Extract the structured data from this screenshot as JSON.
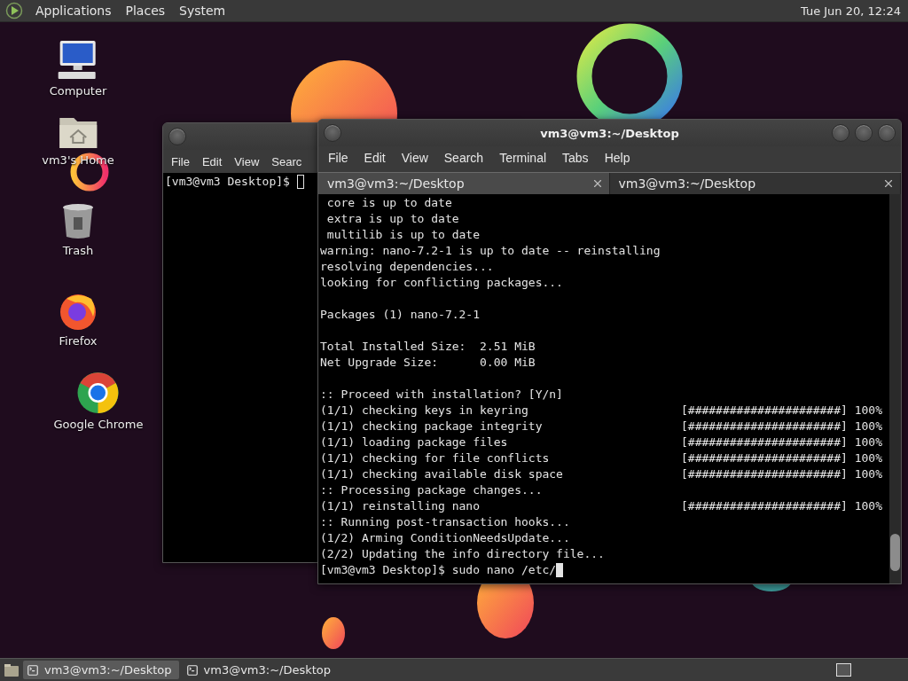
{
  "top_panel": {
    "menus": [
      "Applications",
      "Places",
      "System"
    ],
    "clock": "Tue Jun 20, 12:24"
  },
  "desktop_icons": [
    {
      "kind": "computer",
      "label": "Computer"
    },
    {
      "kind": "home",
      "label": "vm3's Home"
    },
    {
      "kind": "trash",
      "label": "Trash"
    },
    {
      "kind": "firefox",
      "label": "Firefox"
    },
    {
      "kind": "chrome",
      "label": "Google Chrome"
    }
  ],
  "back_window": {
    "menu": [
      "File",
      "Edit",
      "View",
      "Searc"
    ],
    "prompt": "[vm3@vm3 Desktop]$"
  },
  "front_window": {
    "title": "vm3@vm3:~/Desktop",
    "menu": [
      "File",
      "Edit",
      "View",
      "Search",
      "Terminal",
      "Tabs",
      "Help"
    ],
    "tabs": [
      {
        "label": "vm3@vm3:~/Desktop",
        "selected": true
      },
      {
        "label": "vm3@vm3:~/Desktop",
        "selected": false
      }
    ],
    "lines": [
      {
        "kind": "text",
        "text": " core is up to date"
      },
      {
        "kind": "text",
        "text": " extra is up to date"
      },
      {
        "kind": "text",
        "text": " multilib is up to date"
      },
      {
        "kind": "text",
        "text": "warning: nano-7.2-1 is up to date -- reinstalling"
      },
      {
        "kind": "text",
        "text": "resolving dependencies..."
      },
      {
        "kind": "text",
        "text": "looking for conflicting packages..."
      },
      {
        "kind": "blank"
      },
      {
        "kind": "text",
        "text": "Packages (1) nano-7.2-1"
      },
      {
        "kind": "blank"
      },
      {
        "kind": "text",
        "text": "Total Installed Size:  2.51 MiB"
      },
      {
        "kind": "text",
        "text": "Net Upgrade Size:      0.00 MiB"
      },
      {
        "kind": "blank"
      },
      {
        "kind": "text",
        "text": ":: Proceed with installation? [Y/n]"
      },
      {
        "kind": "progress",
        "text": "(1/1) checking keys in keyring",
        "bar": "[######################]",
        "percent": "100%"
      },
      {
        "kind": "progress",
        "text": "(1/1) checking package integrity",
        "bar": "[######################]",
        "percent": "100%"
      },
      {
        "kind": "progress",
        "text": "(1/1) loading package files",
        "bar": "[######################]",
        "percent": "100%"
      },
      {
        "kind": "progress",
        "text": "(1/1) checking for file conflicts",
        "bar": "[######################]",
        "percent": "100%"
      },
      {
        "kind": "progress",
        "text": "(1/1) checking available disk space",
        "bar": "[######################]",
        "percent": "100%"
      },
      {
        "kind": "text",
        "text": ":: Processing package changes..."
      },
      {
        "kind": "progress",
        "text": "(1/1) reinstalling nano",
        "bar": "[######################]",
        "percent": "100%"
      },
      {
        "kind": "text",
        "text": ":: Running post-transaction hooks..."
      },
      {
        "kind": "text",
        "text": "(1/2) Arming ConditionNeedsUpdate..."
      },
      {
        "kind": "text",
        "text": "(2/2) Updating the info directory file..."
      },
      {
        "kind": "prompt",
        "text": "[vm3@vm3 Desktop]$ sudo nano /etc/"
      }
    ]
  },
  "taskbar": {
    "tasks": [
      {
        "label": "vm3@vm3:~/Desktop",
        "selected": true
      },
      {
        "label": "vm3@vm3:~/Desktop",
        "selected": false
      }
    ]
  }
}
